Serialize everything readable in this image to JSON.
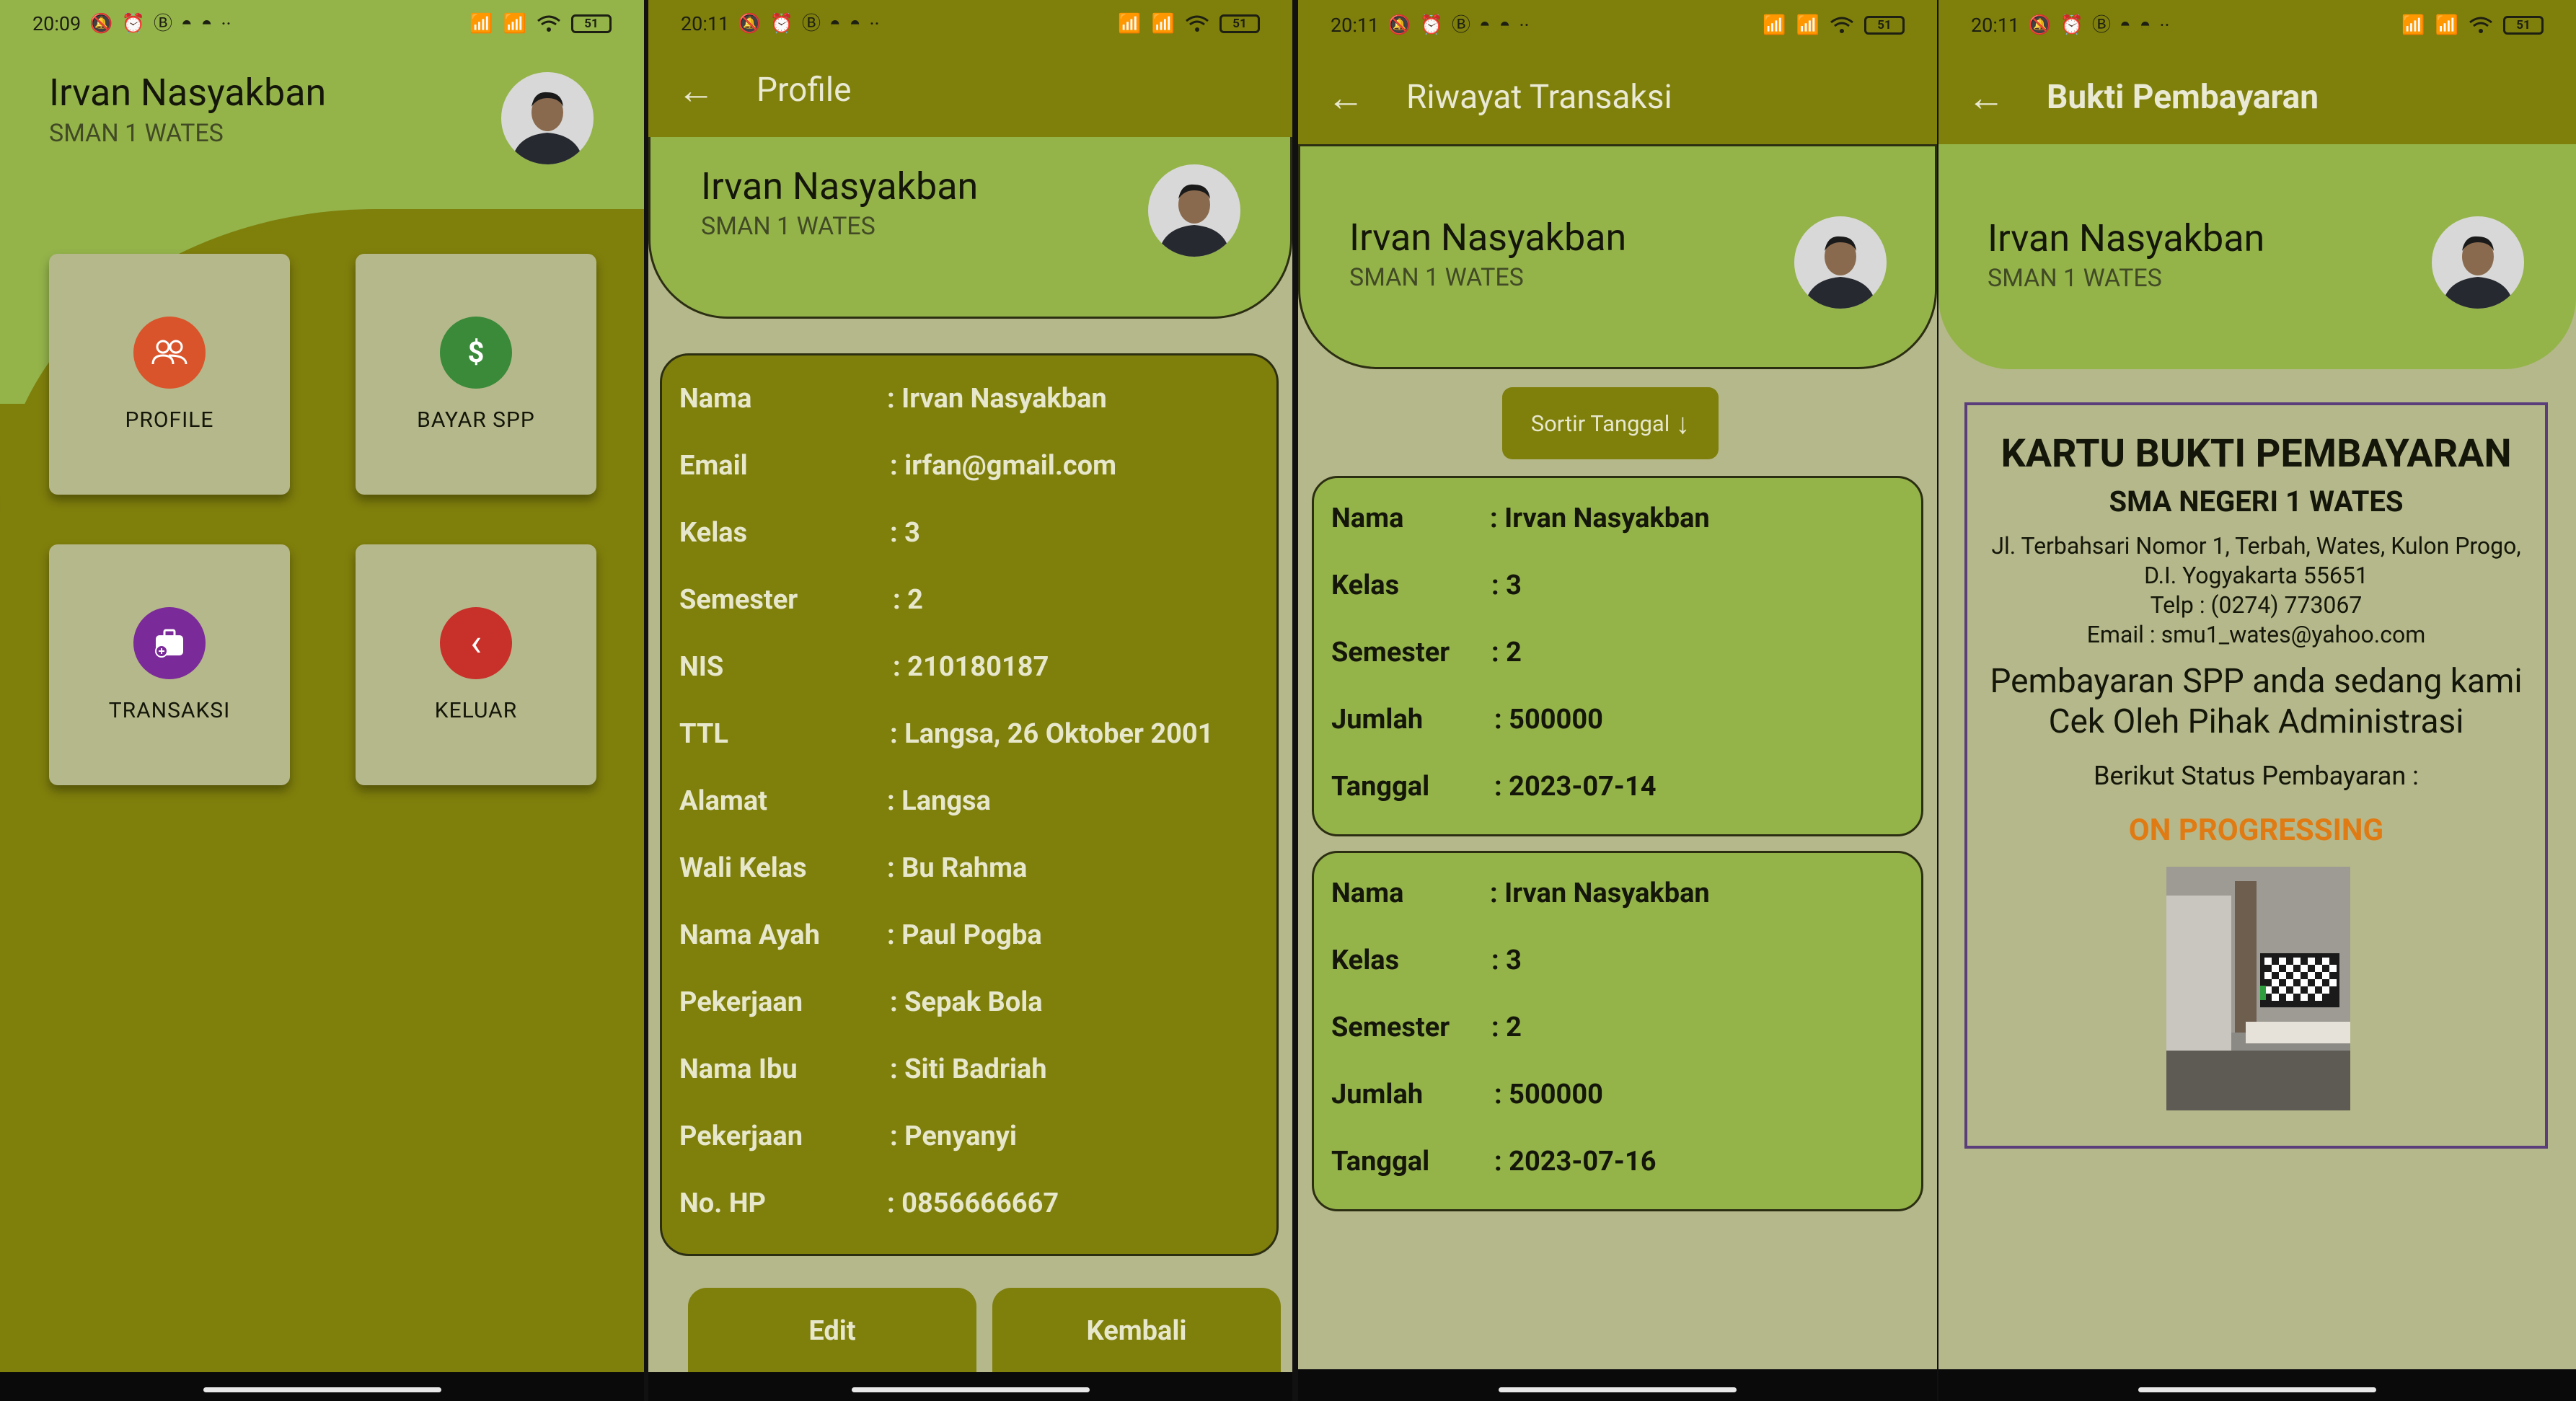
{
  "status": {
    "p1_time": "20:09",
    "p2_time": "20:11",
    "p3_time": "20:11",
    "p4_time": "20:11",
    "battery": "51",
    "more": "··",
    "network": "4G"
  },
  "user": {
    "name": "Irvan Nasyakban",
    "school": "SMAN 1 WATES"
  },
  "dashboard": {
    "menu": [
      {
        "label": "PROFILE",
        "icon": "people-icon",
        "color": "#d9542b"
      },
      {
        "label": "BAYAR SPP",
        "icon": "dollar-icon",
        "color": "#3a8a3a"
      },
      {
        "label": "TRANSAKSI",
        "icon": "wallet-icon",
        "color": "#7b2a9a"
      },
      {
        "label": "KELUAR",
        "icon": "chevron-left-icon",
        "color": "#c8302a"
      }
    ],
    "dollar_glyph": "$",
    "back_glyph": "‹"
  },
  "profile": {
    "title": "Profile",
    "fields": [
      {
        "key": "Nama",
        "value": ": Irvan Nasyakban"
      },
      {
        "key": "Email",
        "value": ": irfan@gmail.com"
      },
      {
        "key": "Kelas",
        "value": ": 3"
      },
      {
        "key": "Semester",
        "value": ": 2"
      },
      {
        "key": "NIS",
        "value": ": 210180187"
      },
      {
        "key": "TTL",
        "value": ": Langsa, 26 Oktober 2001"
      },
      {
        "key": "Alamat",
        "value": ": Langsa"
      },
      {
        "key": "Wali Kelas",
        "value": ": Bu Rahma"
      },
      {
        "key": "Nama Ayah",
        "value": ": Paul Pogba"
      },
      {
        "key": "Pekerjaan",
        "value": ": Sepak Bola"
      },
      {
        "key": "Nama Ibu",
        "value": ": Siti Badriah"
      },
      {
        "key": "Pekerjaan",
        "value": ": Penyanyi"
      },
      {
        "key": "No. HP",
        "value": ": 0856666667"
      }
    ],
    "edit_label": "Edit",
    "back_label": "Kembali"
  },
  "history": {
    "title": "Riwayat Transaksi",
    "sort_label": "Sortir Tanggal",
    "sort_arrow": "↓",
    "transactions": [
      {
        "nama": ": Irvan Nasyakban",
        "kelas": ": 3",
        "semester": ": 2",
        "jumlah": ": 500000",
        "tanggal": ": 2023-07-14"
      },
      {
        "nama": ": Irvan Nasyakban",
        "kelas": ": 3",
        "semester": ": 2",
        "jumlah": ": 500000",
        "tanggal": ": 2023-07-16"
      }
    ],
    "labels": {
      "nama": "Nama",
      "kelas": "Kelas",
      "semester": "Semester",
      "jumlah": "Jumlah",
      "tanggal": "Tanggal"
    }
  },
  "receipt": {
    "title": "Bukti Pembayaran",
    "heading": "KARTU BUKTI PEMBAYARAN",
    "school": "SMA NEGERI 1 WATES",
    "address_line1": "Jl. Terbahsari Nomor 1, Terbah, Wates, Kulon Progo,",
    "address_line2": "D.I. Yogyakarta 55651",
    "phone": "Telp : (0274) 773067",
    "email": "Email : smu1_wates@yahoo.com",
    "message_line1": "Pembayaran SPP anda sedang kami",
    "message_line2": "Cek Oleh Pihak Administrasi",
    "status_label": "Berikut Status Pembayaran :",
    "status_value": "ON PROGRESSING"
  },
  "colors": {
    "dark_olive": "#7f7f0c",
    "light_green": "#94b44a",
    "beige": "#b5b88a",
    "status_orange": "#e07b14",
    "receipt_border": "#5a3d7a"
  }
}
